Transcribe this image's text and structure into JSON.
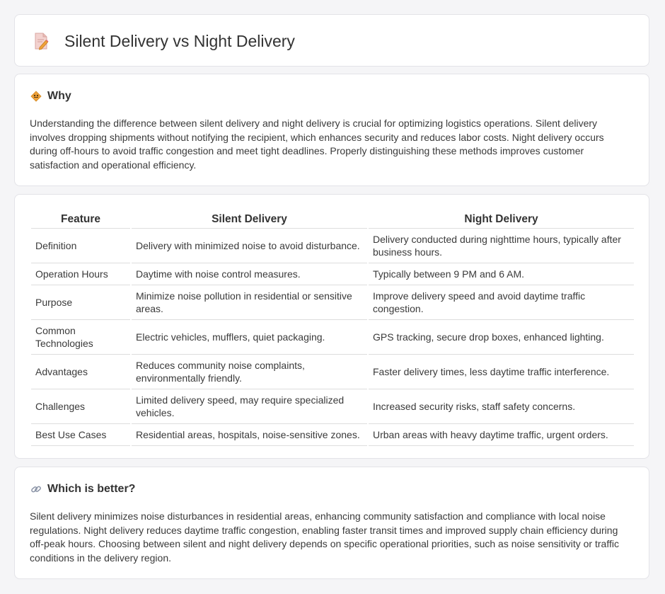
{
  "header": {
    "title": "Silent Delivery vs Night Delivery",
    "icon": "document-pencil-icon"
  },
  "why": {
    "title": "Why",
    "icon": "diamond-sign-icon",
    "text": "Understanding the difference between silent delivery and night delivery is crucial for optimizing logistics operations. Silent delivery involves dropping shipments without notifying the recipient, which enhances security and reduces labor costs. Night delivery occurs during off-hours to avoid traffic congestion and meet tight deadlines. Properly distinguishing these methods improves customer satisfaction and operational efficiency."
  },
  "comparison": {
    "headers": [
      "Feature",
      "Silent Delivery",
      "Night Delivery"
    ],
    "rows": [
      {
        "feature": "Definition",
        "silent": "Delivery with minimized noise to avoid disturbance.",
        "night": "Delivery conducted during nighttime hours, typically after business hours."
      },
      {
        "feature": "Operation Hours",
        "silent": "Daytime with noise control measures.",
        "night": "Typically between 9 PM and 6 AM."
      },
      {
        "feature": "Purpose",
        "silent": "Minimize noise pollution in residential or sensitive areas.",
        "night": "Improve delivery speed and avoid daytime traffic congestion."
      },
      {
        "feature": "Common Technologies",
        "silent": "Electric vehicles, mufflers, quiet packaging.",
        "night": "GPS tracking, secure drop boxes, enhanced lighting."
      },
      {
        "feature": "Advantages",
        "silent": "Reduces community noise complaints, environmentally friendly.",
        "night": "Faster delivery times, less daytime traffic interference."
      },
      {
        "feature": "Challenges",
        "silent": "Limited delivery speed, may require specialized vehicles.",
        "night": "Increased security risks, staff safety concerns."
      },
      {
        "feature": "Best Use Cases",
        "silent": "Residential areas, hospitals, noise-sensitive zones.",
        "night": "Urban areas with heavy daytime traffic, urgent orders."
      }
    ]
  },
  "better": {
    "title": "Which is better?",
    "icon": "link-icon",
    "text": "Silent delivery minimizes noise disturbances in residential areas, enhancing community satisfaction and compliance with local noise regulations. Night delivery reduces daytime traffic congestion, enabling faster transit times and improved supply chain efficiency during off-peak hours. Choosing between silent and night delivery depends on specific operational priorities, such as noise sensitivity or traffic conditions in the delivery region."
  },
  "colors": {
    "background": "#f5f5f7",
    "card": "#ffffff",
    "border": "#e3e3e8",
    "accent_orange": "#f0a23a",
    "accent_pink": "#e8677a"
  }
}
